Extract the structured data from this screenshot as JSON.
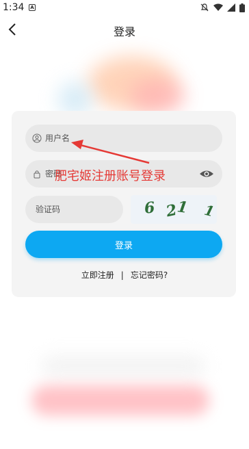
{
  "status_bar": {
    "time": "1:34",
    "app_icon": "A"
  },
  "header": {
    "title": "登录"
  },
  "form": {
    "username": {
      "placeholder": "用户名"
    },
    "password": {
      "placeholder": "密码"
    },
    "captcha": {
      "placeholder": "验证码",
      "chars": [
        "6",
        "2",
        "1",
        "1"
      ]
    },
    "login_label": "登录"
  },
  "links": {
    "register": "立即注册",
    "separator": "|",
    "forgot": "忘记密码?"
  },
  "annotation": {
    "text": "肥宅姬注册账号登录"
  },
  "colors": {
    "accent": "#0da8f2",
    "annotation": "#e53935",
    "captcha_text": "#2f6e38"
  }
}
